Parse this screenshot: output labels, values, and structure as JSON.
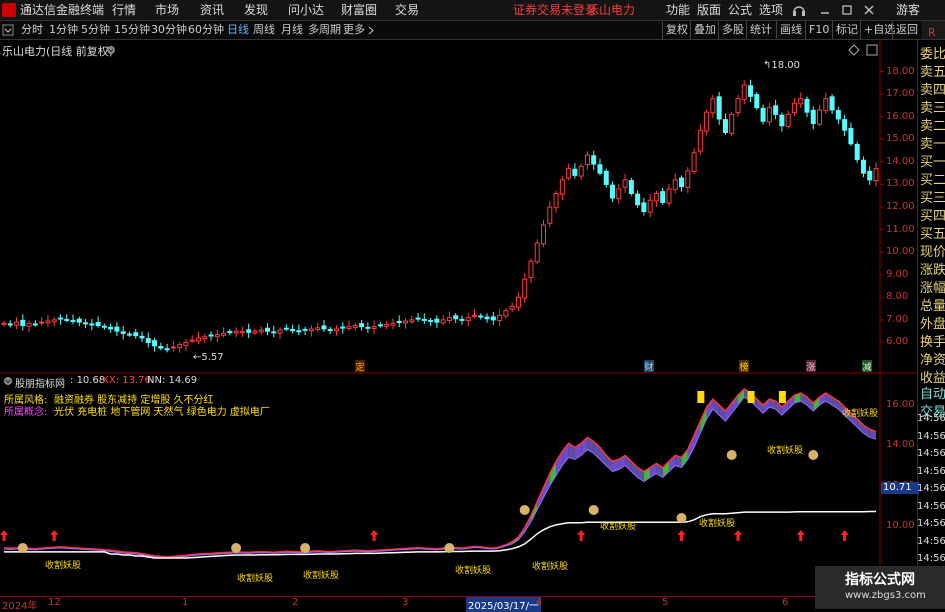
{
  "menubar": {
    "app_title": "通达信金融终端",
    "items": [
      "行情",
      "市场",
      "资讯",
      "发现",
      "问小达",
      "财富圈",
      "交易"
    ],
    "warning": "证券交易未登录",
    "stock_name": "乐山电力",
    "right_items": [
      "功能",
      "版面",
      "公式",
      "选项"
    ],
    "guest": "游客"
  },
  "periodbar": {
    "periods": [
      "分时",
      "1分钟",
      "5分钟",
      "15分钟",
      "30分钟",
      "60分钟",
      "日线",
      "周线",
      "月线",
      "多周期",
      "更多"
    ],
    "active": "日线",
    "buttons": [
      "复权",
      "叠加",
      "多股",
      "统计",
      "画线",
      "F10",
      "标记",
      "+自选",
      "返回"
    ]
  },
  "right_column": {
    "items": [
      "委比",
      "卖五",
      "卖四",
      "卖三",
      "卖二",
      "卖一",
      "买一",
      "买二",
      "买三",
      "买四",
      "买五",
      "现价",
      "涨跌",
      "涨幅",
      "总量",
      "外盘",
      "换手",
      "净资",
      "收益",
      "自动",
      "交易"
    ]
  },
  "main_chart": {
    "title": "乐山电力(日线 前复权)",
    "high_label": "18.00",
    "low_label": "5.57",
    "markers": [
      "定",
      "财",
      "榜",
      "涨",
      "减"
    ]
  },
  "indicator": {
    "name": "股朋指标网",
    "v1_label": "10.68",
    "xx_label": "XX: 13.76",
    "nn_label": "NN: 14.69",
    "style_label": "所属风格:",
    "style_value": "融资融券 股东减持 定增股 久不分红",
    "concept_label": "所属概念:",
    "concept_value": "光伏 充电桩 地下管网 天然气 绿色电力 虚拟电厂",
    "tag_text": "收割妖股",
    "current_value": "10.71"
  },
  "x_axis": {
    "labels": [
      "2024年",
      "12",
      "1",
      "2",
      "3",
      "2025/03/17/一",
      "4",
      "5",
      "6"
    ]
  },
  "watermark": {
    "line1": "指标公式网",
    "line2": "www.zbgs3.com"
  },
  "chart_data": [
    {
      "type": "candlestick",
      "title": "乐山电力(日线 前复权)",
      "ylim": [
        5.4,
        18.6
      ],
      "yticks": [
        6.0,
        7.0,
        8.0,
        9.0,
        10.0,
        11.0,
        12.0,
        13.0,
        14.0,
        15.0,
        16.0,
        17.0,
        18.0
      ],
      "close": [
        6.85,
        6.8,
        6.9,
        6.75,
        6.85,
        6.8,
        6.9,
        6.95,
        7.0,
        7.05,
        7.0,
        6.95,
        6.9,
        6.85,
        6.8,
        6.75,
        6.7,
        6.6,
        6.5,
        6.4,
        6.35,
        6.3,
        6.2,
        6.0,
        5.85,
        5.75,
        5.7,
        5.8,
        5.9,
        6.0,
        6.1,
        6.2,
        6.25,
        6.3,
        6.35,
        6.4,
        6.45,
        6.5,
        6.48,
        6.45,
        6.5,
        6.55,
        6.5,
        6.45,
        6.55,
        6.6,
        6.55,
        6.5,
        6.55,
        6.6,
        6.65,
        6.6,
        6.55,
        6.6,
        6.65,
        6.7,
        6.75,
        6.7,
        6.65,
        6.7,
        6.75,
        6.8,
        6.85,
        6.9,
        6.95,
        7.0,
        7.05,
        7.0,
        6.95,
        6.9,
        7.0,
        7.1,
        7.05,
        7.0,
        7.1,
        7.2,
        7.15,
        7.05,
        7.0,
        7.2,
        7.4,
        7.6,
        8.0,
        8.8,
        9.6,
        10.4,
        11.2,
        12.0,
        12.6,
        13.2,
        13.7,
        13.4,
        13.8,
        14.3,
        13.9,
        13.5,
        13.0,
        12.4,
        12.8,
        13.2,
        12.6,
        12.1,
        11.8,
        12.3,
        12.6,
        12.2,
        12.8,
        13.2,
        12.9,
        13.6,
        14.4,
        15.4,
        16.2,
        16.8,
        15.9,
        15.3,
        16.1,
        16.8,
        17.4,
        16.9,
        16.4,
        15.8,
        16.4,
        16.1,
        15.6,
        16.1,
        16.6,
        16.8,
        16.2,
        15.7,
        16.3,
        16.8,
        16.3,
        15.9,
        15.4,
        14.8,
        14.1,
        13.5,
        13.2,
        13.7
      ],
      "high_label": 18.0,
      "low_label": 5.57
    },
    {
      "type": "line",
      "title": "股朋指标网",
      "ylim": [
        8.2,
        17.0
      ],
      "yticks": [
        10.0,
        12.0,
        14.0,
        16.0
      ],
      "series": [
        {
          "name": "XX",
          "values": [
            8.85,
            8.82,
            8.85,
            8.8,
            8.82,
            8.8,
            8.84,
            8.86,
            8.88,
            8.9,
            8.88,
            8.86,
            8.84,
            8.82,
            8.8,
            8.78,
            8.76,
            8.72,
            8.68,
            8.64,
            8.62,
            8.6,
            8.56,
            8.5,
            8.45,
            8.42,
            8.4,
            8.42,
            8.45,
            8.48,
            8.52,
            8.55,
            8.57,
            8.58,
            8.6,
            8.62,
            8.63,
            8.65,
            8.64,
            8.63,
            8.65,
            8.66,
            8.65,
            8.63,
            8.66,
            8.68,
            8.67,
            8.65,
            8.66,
            8.68,
            8.7,
            8.68,
            8.66,
            8.68,
            8.7,
            8.72,
            8.74,
            8.72,
            8.7,
            8.72,
            8.74,
            8.76,
            8.78,
            8.8,
            8.82,
            8.84,
            8.86,
            8.84,
            8.82,
            8.8,
            8.84,
            8.88,
            8.86,
            8.84,
            8.88,
            8.92,
            8.9,
            8.86,
            8.84,
            8.9,
            9.0,
            9.1,
            9.3,
            9.7,
            10.2,
            10.8,
            11.4,
            12.0,
            12.5,
            13.0,
            13.4,
            13.3,
            13.5,
            13.8,
            13.6,
            13.3,
            13.0,
            12.7,
            12.8,
            13.0,
            12.7,
            12.4,
            12.2,
            12.4,
            12.6,
            12.4,
            12.7,
            13.0,
            12.9,
            13.3,
            13.9,
            14.6,
            15.3,
            15.8,
            15.5,
            15.2,
            15.6,
            16.0,
            16.4,
            16.2,
            15.9,
            15.6,
            15.9,
            15.8,
            15.5,
            15.8,
            16.1,
            16.2,
            16.0,
            15.7,
            16.0,
            16.2,
            16.0,
            15.8,
            15.5,
            15.2,
            14.9,
            14.6,
            14.4,
            14.3
          ]
        },
        {
          "name": "NN",
          "values": [
            8.9,
            8.88,
            8.9,
            8.86,
            8.88,
            8.86,
            8.89,
            8.91,
            8.93,
            8.95,
            8.93,
            8.91,
            8.89,
            8.87,
            8.85,
            8.83,
            8.81,
            8.78,
            8.74,
            8.7,
            8.68,
            8.66,
            8.62,
            8.56,
            8.51,
            8.48,
            8.46,
            8.48,
            8.51,
            8.54,
            8.57,
            8.6,
            8.62,
            8.63,
            8.65,
            8.67,
            8.68,
            8.7,
            8.69,
            8.68,
            8.7,
            8.71,
            8.7,
            8.68,
            8.71,
            8.73,
            8.72,
            8.7,
            8.71,
            8.73,
            8.75,
            8.73,
            8.71,
            8.73,
            8.75,
            8.77,
            8.79,
            8.77,
            8.75,
            8.77,
            8.79,
            8.81,
            8.83,
            8.85,
            8.87,
            8.89,
            8.91,
            8.89,
            8.87,
            8.85,
            8.89,
            8.93,
            8.91,
            8.89,
            8.93,
            8.97,
            8.95,
            8.91,
            8.89,
            8.95,
            9.05,
            9.2,
            9.45,
            9.9,
            10.5,
            11.2,
            11.9,
            12.6,
            13.2,
            13.7,
            14.1,
            13.9,
            14.1,
            14.4,
            14.2,
            13.9,
            13.5,
            13.2,
            13.3,
            13.5,
            13.2,
            12.9,
            12.7,
            12.9,
            13.1,
            12.9,
            13.2,
            13.5,
            13.4,
            13.8,
            14.5,
            15.2,
            15.9,
            16.3,
            16.0,
            15.7,
            16.1,
            16.5,
            16.8,
            16.6,
            16.3,
            16.0,
            16.3,
            16.2,
            15.9,
            16.2,
            16.5,
            16.6,
            16.4,
            16.1,
            16.4,
            16.6,
            16.4,
            16.2,
            15.9,
            15.6,
            15.3,
            15.0,
            14.8,
            14.69
          ]
        },
        {
          "name": "",
          "values": [
            8.7,
            8.7,
            8.7,
            8.7,
            8.7,
            8.7,
            8.7,
            8.7,
            8.7,
            8.7,
            8.7,
            8.7,
            8.7,
            8.7,
            8.7,
            8.7,
            8.7,
            8.6,
            8.6,
            8.55,
            8.55,
            8.5,
            8.5,
            8.45,
            8.4,
            8.4,
            8.4,
            8.4,
            8.4,
            8.4,
            8.42,
            8.44,
            8.46,
            8.48,
            8.5,
            8.52,
            8.54,
            8.55,
            8.55,
            8.55,
            8.55,
            8.56,
            8.56,
            8.56,
            8.57,
            8.58,
            8.58,
            8.58,
            8.58,
            8.59,
            8.6,
            8.6,
            8.6,
            8.6,
            8.61,
            8.62,
            8.63,
            8.63,
            8.63,
            8.63,
            8.64,
            8.65,
            8.66,
            8.67,
            8.68,
            8.69,
            8.7,
            8.7,
            8.7,
            8.7,
            8.71,
            8.72,
            8.72,
            8.72,
            8.73,
            8.74,
            8.74,
            8.74,
            8.74,
            8.76,
            8.8,
            8.86,
            8.95,
            9.1,
            9.35,
            9.6,
            9.8,
            9.95,
            10.05,
            10.1,
            10.15,
            10.15,
            10.15,
            10.18,
            10.18,
            10.18,
            10.18,
            10.18,
            10.18,
            10.18,
            10.18,
            10.18,
            10.18,
            10.18,
            10.18,
            10.18,
            10.18,
            10.18,
            10.18,
            10.2,
            10.3,
            10.45,
            10.55,
            10.6,
            10.6,
            10.6,
            10.62,
            10.65,
            10.68,
            10.68,
            10.68,
            10.68,
            10.68,
            10.68,
            10.68,
            10.68,
            10.69,
            10.7,
            10.7,
            10.7,
            10.7,
            10.7,
            10.7,
            10.7,
            10.7,
            10.7,
            10.7,
            10.7,
            10.71,
            10.71
          ]
        }
      ],
      "current_value": 10.71
    }
  ]
}
